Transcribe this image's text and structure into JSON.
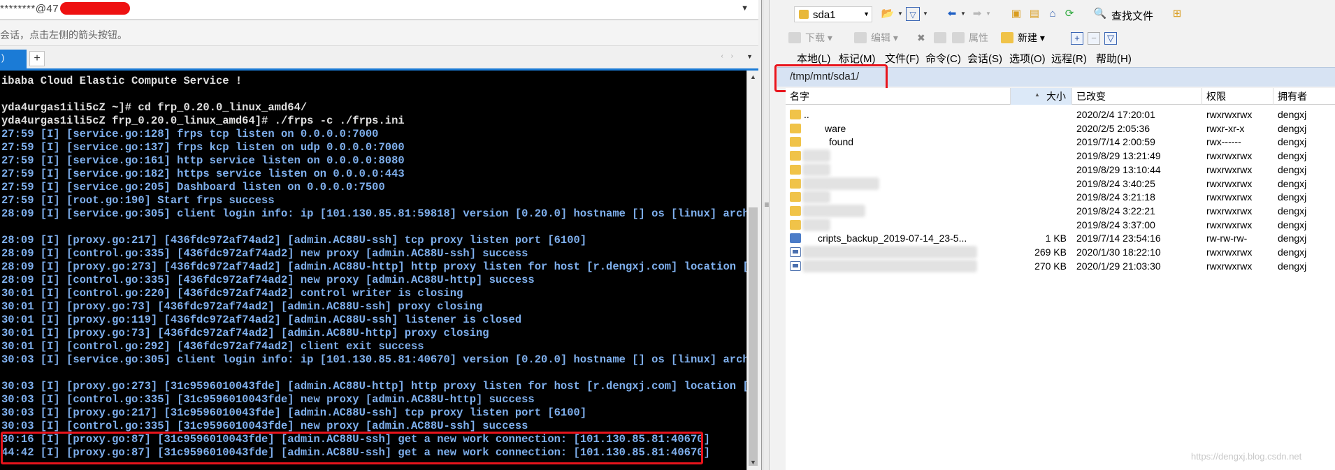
{
  "left_pane": {
    "address": "********@47",
    "hint": "会话，点击左侧的箭头按钮。",
    "tab_add_label": "+",
    "tab_nav_label": "‹ ›",
    "terminal_lines": [
      {
        "text": "ibaba Cloud Elastic Compute Service !",
        "style": "plain"
      },
      {
        "text": "",
        "style": "plain"
      },
      {
        "text": "yda4urgas1ili5cZ ~]# cd frp_0.20.0_linux_amd64/",
        "style": "plain"
      },
      {
        "text": "yda4urgas1ili5cZ frp_0.20.0_linux_amd64]# ./frps -c ./frps.ini",
        "style": "plain"
      },
      {
        "text": "27:59 [I] [service.go:128] frps tcp listen on 0.0.0.0:7000",
        "style": "log"
      },
      {
        "text": "27:59 [I] [service.go:137] frps kcp listen on udp 0.0.0.0:7000",
        "style": "log"
      },
      {
        "text": "27:59 [I] [service.go:161] http service listen on 0.0.0.0:8080",
        "style": "log"
      },
      {
        "text": "27:59 [I] [service.go:182] https service listen on 0.0.0.0:443",
        "style": "log"
      },
      {
        "text": "27:59 [I] [service.go:205] Dashboard listen on 0.0.0.0:7500",
        "style": "log"
      },
      {
        "text": "27:59 [I] [root.go:190] Start frps success",
        "style": "log"
      },
      {
        "text": "28:09 [I] [service.go:305] client login info: ip [101.130.85.81:59818] version [0.20.0] hostname [] os [linux] arch [",
        "style": "log"
      },
      {
        "text": "",
        "style": "log"
      },
      {
        "text": "28:09 [I] [proxy.go:217] [436fdc972af74ad2] [admin.AC88U-ssh] tcp proxy listen port [6100]",
        "style": "log"
      },
      {
        "text": "28:09 [I] [control.go:335] [436fdc972af74ad2] new proxy [admin.AC88U-ssh] success",
        "style": "log"
      },
      {
        "text": "28:09 [I] [proxy.go:273] [436fdc972af74ad2] [admin.AC88U-http] http proxy listen for host [r.dengxj.com] location []",
        "style": "log"
      },
      {
        "text": "28:09 [I] [control.go:335] [436fdc972af74ad2] new proxy [admin.AC88U-http] success",
        "style": "log"
      },
      {
        "text": "30:01 [I] [control.go:220] [436fdc972af74ad2] control writer is closing",
        "style": "log"
      },
      {
        "text": "30:01 [I] [proxy.go:73] [436fdc972af74ad2] [admin.AC88U-ssh] proxy closing",
        "style": "log"
      },
      {
        "text": "30:01 [I] [proxy.go:119] [436fdc972af74ad2] [admin.AC88U-ssh] listener is closed",
        "style": "log"
      },
      {
        "text": "30:01 [I] [proxy.go:73] [436fdc972af74ad2] [admin.AC88U-http] proxy closing",
        "style": "log"
      },
      {
        "text": "30:01 [I] [control.go:292] [436fdc972af74ad2] client exit success",
        "style": "log"
      },
      {
        "text": "30:03 [I] [service.go:305] client login info: ip [101.130.85.81:40670] version [0.20.0] hostname [] os [linux] arch [",
        "style": "log"
      },
      {
        "text": "",
        "style": "log"
      },
      {
        "text": "30:03 [I] [proxy.go:273] [31c9596010043fde] [admin.AC88U-http] http proxy listen for host [r.dengxj.com] location []",
        "style": "log"
      },
      {
        "text": "30:03 [I] [control.go:335] [31c9596010043fde] new proxy [admin.AC88U-http] success",
        "style": "log"
      },
      {
        "text": "30:03 [I] [proxy.go:217] [31c9596010043fde] [admin.AC88U-ssh] tcp proxy listen port [6100]",
        "style": "log"
      },
      {
        "text": "30:03 [I] [control.go:335] [31c9596010043fde] new proxy [admin.AC88U-ssh] success",
        "style": "log"
      },
      {
        "text": "30:16 [I] [proxy.go:87] [31c9596010043fde] [admin.AC88U-ssh] get a new work connection: [101.130.85.81:40670]",
        "style": "log"
      },
      {
        "text": "44:42 [I] [proxy.go:87] [31c9596010043fde] [admin.AC88U-ssh] get a new work connection: [101.130.85.81:40670]",
        "style": "log"
      }
    ]
  },
  "right_pane": {
    "location": "sda1",
    "find_files": "查找文件",
    "toolbar2": {
      "download": "下载",
      "edit": "编辑",
      "properties": "属性",
      "new": "新建"
    },
    "menu": [
      "本地(L)",
      "标记(M)",
      "文件(F)",
      "命令(C)",
      "会话(S)",
      "选项(O)",
      "远程(R)",
      "帮助(H)"
    ],
    "path": "/tmp/mnt/sda1/",
    "columns": [
      "名字",
      "大小",
      "已改变",
      "权限",
      "拥有者"
    ],
    "files": [
      {
        "name": "..",
        "icon": "folder",
        "size": "",
        "modified": "2020/2/4 17:20:01",
        "perms": "rwxrwxrwx",
        "owner": "dengxj",
        "blur": 0
      },
      {
        "name": "ware",
        "icon": "folder",
        "size": "",
        "modified": "2020/2/5 2:05:36",
        "perms": "rwxr-xr-x",
        "owner": "dengxj",
        "blur": 0
      },
      {
        "name": "found",
        "icon": "folder",
        "size": "",
        "modified": "2019/7/14 2:00:59",
        "perms": "rwx------",
        "owner": "dengxj",
        "blur": 0
      },
      {
        "name": "",
        "icon": "folder",
        "size": "",
        "modified": "2019/8/29 13:21:49",
        "perms": "rwxrwxrwx",
        "owner": "dengxj",
        "blur": 40
      },
      {
        "name": "",
        "icon": "folder",
        "size": "",
        "modified": "2019/8/29 13:10:44",
        "perms": "rwxrwxrwx",
        "owner": "dengxj",
        "blur": 40
      },
      {
        "name": "",
        "icon": "folder",
        "size": "",
        "modified": "2019/8/24 3:40:25",
        "perms": "rwxrwxrwx",
        "owner": "dengxj",
        "blur": 110
      },
      {
        "name": "",
        "icon": "folder",
        "size": "",
        "modified": "2019/8/24 3:21:18",
        "perms": "rwxrwxrwx",
        "owner": "dengxj",
        "blur": 40
      },
      {
        "name": "",
        "icon": "folder",
        "size": "",
        "modified": "2019/8/24 3:22:21",
        "perms": "rwxrwxrwx",
        "owner": "dengxj",
        "blur": 90
      },
      {
        "name": "",
        "icon": "folder",
        "size": "",
        "modified": "2019/8/24 3:37:00",
        "perms": "rwxrwxrwx",
        "owner": "dengxj",
        "blur": 40
      },
      {
        "name": "cripts_backup_2019-07-14_23-5...",
        "icon": "archive",
        "size": "1 KB",
        "modified": "2019/7/14 23:54:16",
        "perms": "rw-rw-rw-",
        "owner": "dengxj",
        "blur": 0
      },
      {
        "name": "",
        "icon": "doc",
        "size": "269 KB",
        "modified": "2020/1/30 18:22:10",
        "perms": "rwxrwxrwx",
        "owner": "dengxj",
        "blur": 250
      },
      {
        "name": "",
        "icon": "doc",
        "size": "270 KB",
        "modified": "2020/1/29 21:03:30",
        "perms": "rwxrwxrwx",
        "owner": "dengxj",
        "blur": 250
      }
    ]
  },
  "watermark": "https://dengxj.blog.csdn.net",
  "colors": {
    "highlight": "#e8141c",
    "terminal_bg": "#000000",
    "terminal_log": "#7fb0ee",
    "accent": "#1b7bd6"
  }
}
